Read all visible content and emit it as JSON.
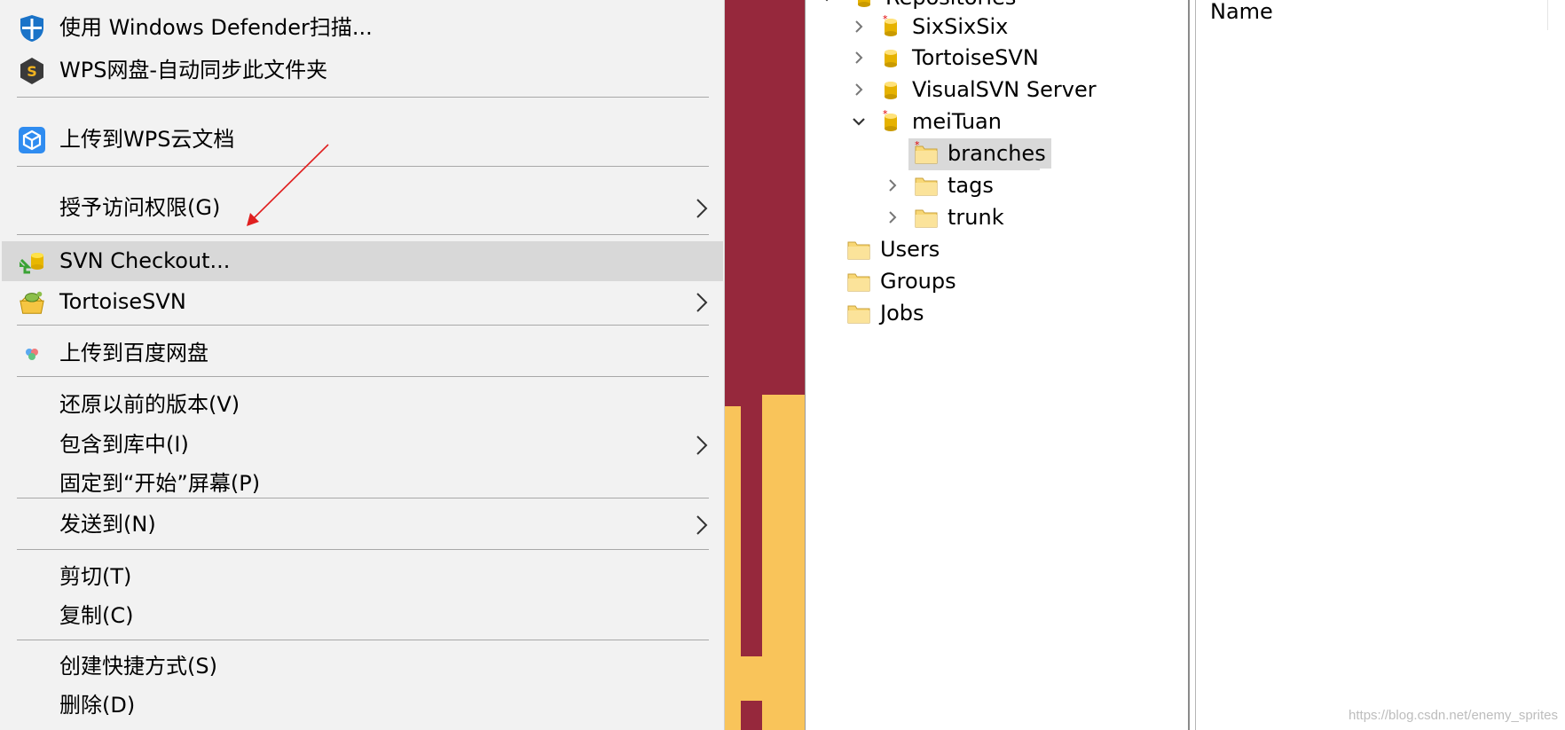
{
  "context_menu": {
    "items": [
      {
        "label": "使用 Windows Defender扫描..."
      },
      {
        "label": "WPS网盘-自动同步此文件夹"
      },
      {
        "label": "上传到WPS云文档"
      },
      {
        "label": "授予访问权限(G)"
      },
      {
        "label": "SVN Checkout..."
      },
      {
        "label": "TortoiseSVN"
      },
      {
        "label": "上传到百度网盘"
      },
      {
        "label": "还原以前的版本(V)"
      },
      {
        "label": "包含到库中(I)"
      },
      {
        "label": "固定到“开始”屏幕(P)"
      },
      {
        "label": "发送到(N)"
      },
      {
        "label": "剪切(T)"
      },
      {
        "label": "复制(C)"
      },
      {
        "label": "创建快捷方式(S)"
      },
      {
        "label": "删除(D)"
      }
    ]
  },
  "tree": {
    "root_label": "Repositories",
    "repos": [
      "SixSixSix",
      "TortoiseSVN",
      "VisualSVN Server",
      "meiTuan"
    ],
    "meituan_children": [
      "branches",
      "tags",
      "trunk"
    ],
    "other_nodes": [
      "Users",
      "Groups",
      "Jobs"
    ]
  },
  "list": {
    "column_name": "Name"
  },
  "watermark": "https://blog.csdn.net/enemy_sprites",
  "colors": {
    "highlight": "#d8d8d8",
    "background_red": "#96283c",
    "background_yellow": "#f9c45a",
    "annotation_arrow": "#e02020"
  }
}
